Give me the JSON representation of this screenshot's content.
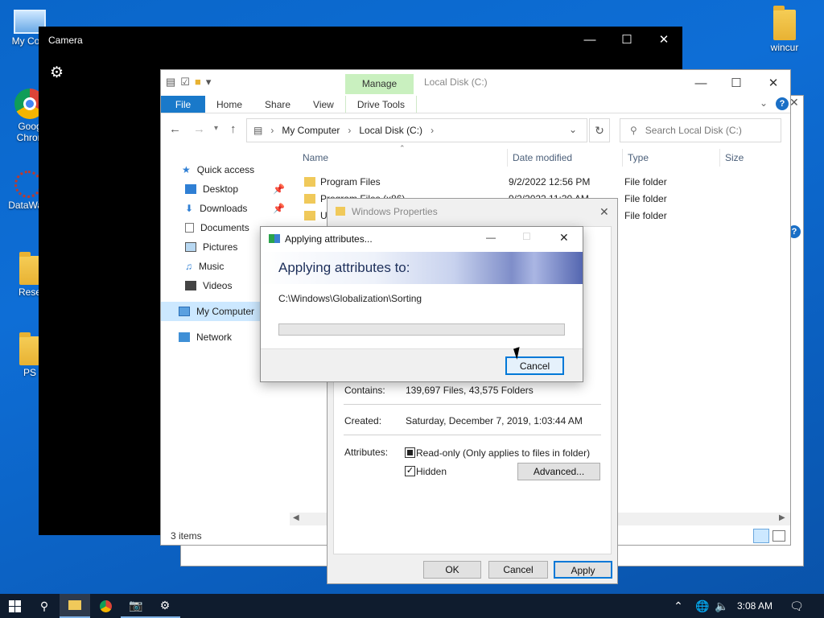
{
  "desktop": {
    "icons": [
      {
        "label": "My Com",
        "icon": "computer-icon"
      },
      {
        "label": "Goog\nChron",
        "icon": "chrome-icon"
      },
      {
        "label": "DataWag",
        "icon": "app-icon"
      },
      {
        "label": "Rese",
        "icon": "folder-icon"
      },
      {
        "label": "PS",
        "icon": "folder-icon"
      },
      {
        "label": "wincur",
        "icon": "folder-icon"
      }
    ]
  },
  "camera": {
    "title": "Camera"
  },
  "explorer": {
    "context_tab": "Manage",
    "title": "Local Disk (C:)",
    "ribbon": {
      "file": "File",
      "home": "Home",
      "share": "Share",
      "view": "View",
      "drive_tools": "Drive Tools"
    },
    "breadcrumb": [
      "My Computer",
      "Local Disk (C:)"
    ],
    "search_placeholder": "Search Local Disk (C:)",
    "nav": {
      "quick_access": "Quick access",
      "desktop": "Desktop",
      "downloads": "Downloads",
      "documents": "Documents",
      "pictures": "Pictures",
      "music": "Music",
      "videos": "Videos",
      "my_computer": "My Computer",
      "network": "Network"
    },
    "columns": {
      "name": "Name",
      "date": "Date modified",
      "type": "Type",
      "size": "Size"
    },
    "rows": [
      {
        "name": "Program Files",
        "date": "9/2/2022 12:56 PM",
        "type": "File folder"
      },
      {
        "name": "Program Files (x86)",
        "date": "9/2/2022 11:30 AM",
        "type": "File folder"
      },
      {
        "name": "U",
        "date": "",
        "type": "File folder"
      }
    ],
    "status": "3 items"
  },
  "properties": {
    "title": "Windows Properties",
    "contains_label": "Contains:",
    "contains_value": "139,697 Files, 43,575 Folders",
    "created_label": "Created:",
    "created_value": "Saturday, December 7, 2019, 1:03:44 AM",
    "attributes_label": "Attributes:",
    "readonly_label": "Read-only (Only applies to files in folder)",
    "hidden_label": "Hidden",
    "advanced_label": "Advanced...",
    "ok": "OK",
    "cancel": "Cancel",
    "apply": "Apply"
  },
  "applying": {
    "title": "Applying attributes...",
    "heading": "Applying attributes to:",
    "path": "C:\\Windows\\Globalization\\Sorting",
    "progress": 0.0,
    "cancel": "Cancel"
  },
  "taskbar": {
    "time": "3:08 AM"
  }
}
